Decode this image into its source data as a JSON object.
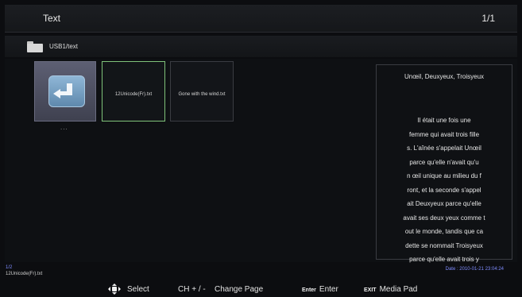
{
  "header": {
    "title": "Text",
    "page_indicator": "1/1"
  },
  "path_bar": {
    "icon": "folder-icon",
    "path": "USB1/text"
  },
  "browser": {
    "up_item": {
      "icon": "return-arrow-icon",
      "label": "..."
    },
    "files": [
      {
        "name": "12Unicode(Fr).txt",
        "selected": true
      },
      {
        "name": "Gone with the wind.txt",
        "selected": false
      }
    ]
  },
  "preview": {
    "title": "Unœil, Deuxyeux, Troisyeux",
    "lines": [
      "Il était une fois une",
      "femme qui avait trois fille",
      "s. L'aînée s'appelait Unœil",
      "parce qu'elle n'avait qu'u",
      "n œil unique au milieu du f",
      "ront, et la seconde s'appel",
      "ait Deuxyeux parce qu'elle",
      "avait ses deux yeux comme t",
      "out le monde, tandis que ca",
      "dette se nommait Troisyeux",
      "parce qu'elle avait trois y"
    ]
  },
  "status": {
    "index": "1/2",
    "selected_file": "12Unicode(Fr).txt",
    "date": "Date : 2010-01-21 23:04:24"
  },
  "hints": {
    "select_label": "Select",
    "change_page_key": "CH + / -",
    "change_page_label": "Change Page",
    "enter_key": "Enter",
    "enter_label": "Enter",
    "exit_key": "EXIT",
    "exit_label": "Media Pad"
  },
  "colors": {
    "selection_border": "#7fc27a",
    "accent_text": "#7f8cff"
  }
}
